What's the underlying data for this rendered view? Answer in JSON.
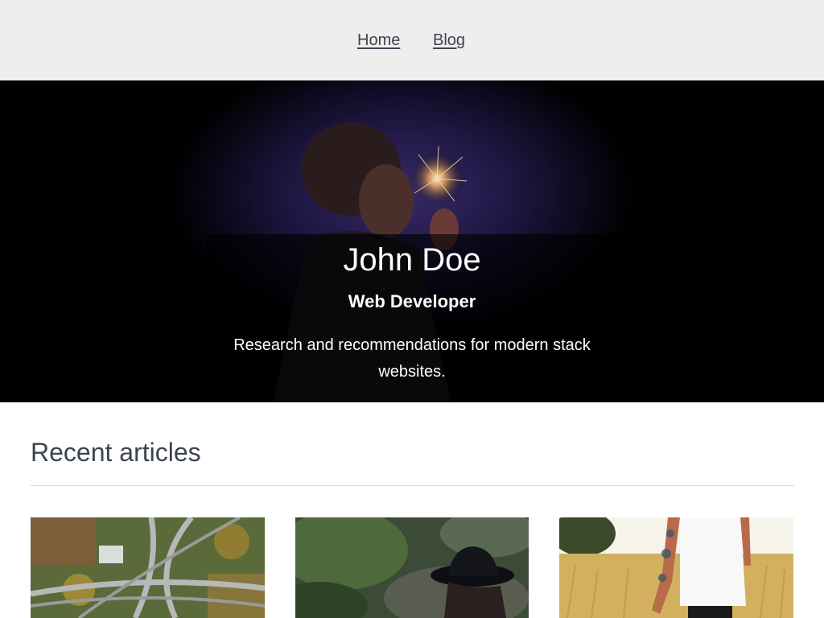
{
  "nav": {
    "home_label": "Home",
    "blog_label": "Blog"
  },
  "hero": {
    "name": "John Doe",
    "role": "Web Developer",
    "description": "Research and recommendations for modern stack websites."
  },
  "articles": {
    "title": "Recent articles",
    "cards": [
      {
        "image": "highway-interchange-aerial-photo"
      },
      {
        "image": "woman-in-black-hat-forest-photo"
      },
      {
        "image": "tattooed-person-in-wheat-field-photo"
      }
    ]
  },
  "colors": {
    "nav_background": "#eeeeee",
    "text": "#3d4450",
    "hero_background": "#000000",
    "divider": "#d9d9d9"
  }
}
